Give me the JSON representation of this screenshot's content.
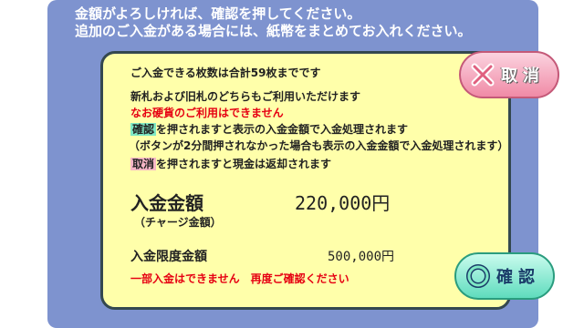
{
  "header": {
    "line1": "金額がよろしければ、確認を押してください。",
    "line2": "追加のご入金がある場合には、紙幣をまとめてお入れください。"
  },
  "info": {
    "limit_count": "ご入金できる枚数は合計59枚までです",
    "notes_ok": "新札および旧札のどちらもご利用いただけます",
    "coins_ng": "なお硬貨のご利用はできません",
    "confirm_key": "確認",
    "confirm_desc": "を押されますと表示の入金金額で入金処理されます",
    "timeout_note": "（ボタンが2分間押されなかった場合も表示の入金金額で入金処理されます）",
    "cancel_key": "取消",
    "cancel_desc": "を押されますと現金は返却されます"
  },
  "amount": {
    "label": "入金金額",
    "sub_label": "（チャージ金額）",
    "value": "220,000円"
  },
  "limit": {
    "label": "入金限度金額",
    "value": "500,000円"
  },
  "warning": "一部入金はできません　再度ご確認ください",
  "buttons": {
    "cancel": "取消",
    "confirm": "確認"
  },
  "colors": {
    "background": "#7e93cf",
    "panel": "#ffffaa",
    "alert": "#e60012",
    "cancel_button": "#f08aa6",
    "confirm_button": "#5fdcbd"
  }
}
